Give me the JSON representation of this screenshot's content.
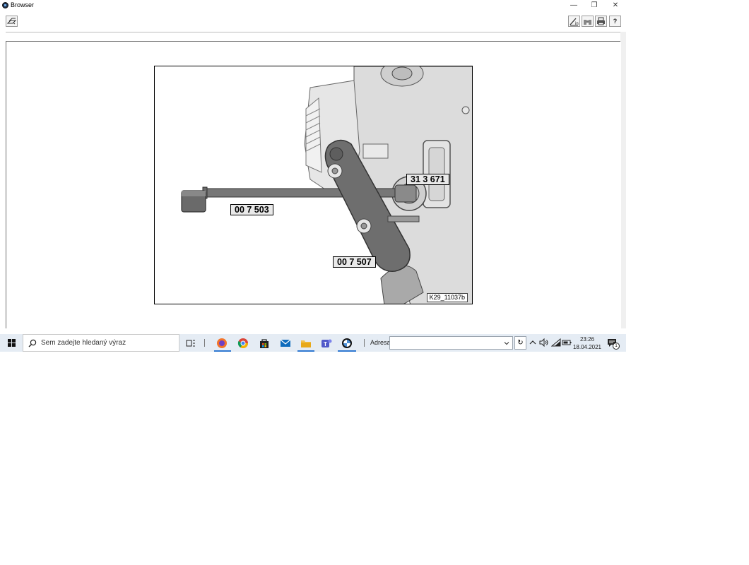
{
  "window": {
    "title": "Browser",
    "minimize_glyph": "—",
    "restore_glyph": "❐",
    "close_glyph": "✕"
  },
  "toolbar": {
    "left_icon": "layers-icon",
    "right_icons": [
      "notes-icon",
      "binoculars-icon",
      "printer-icon",
      "help-icon"
    ],
    "help_glyph": "?"
  },
  "figure": {
    "labels": {
      "tool_a": "31 3 671",
      "tool_b": "00 7 503",
      "tool_c": "00 7 507"
    },
    "figure_id": "K29_11037b"
  },
  "taskbar": {
    "search_placeholder": "Sem zadejte hledaný výraz",
    "pinned_apps": [
      "task-view",
      "firefox",
      "chrome",
      "store",
      "mail",
      "file-explorer",
      "teams",
      "bmw-browser"
    ],
    "address_label": "Adresa",
    "address_value": "",
    "refresh_glyph": "↻",
    "time": "23:26",
    "date": "18.04.2021",
    "notification_count": "1"
  },
  "colors": {
    "taskbar_bg": "#e5ecf4",
    "active_underline": "#2f78d1",
    "label_bg": "#e9e9e9"
  }
}
